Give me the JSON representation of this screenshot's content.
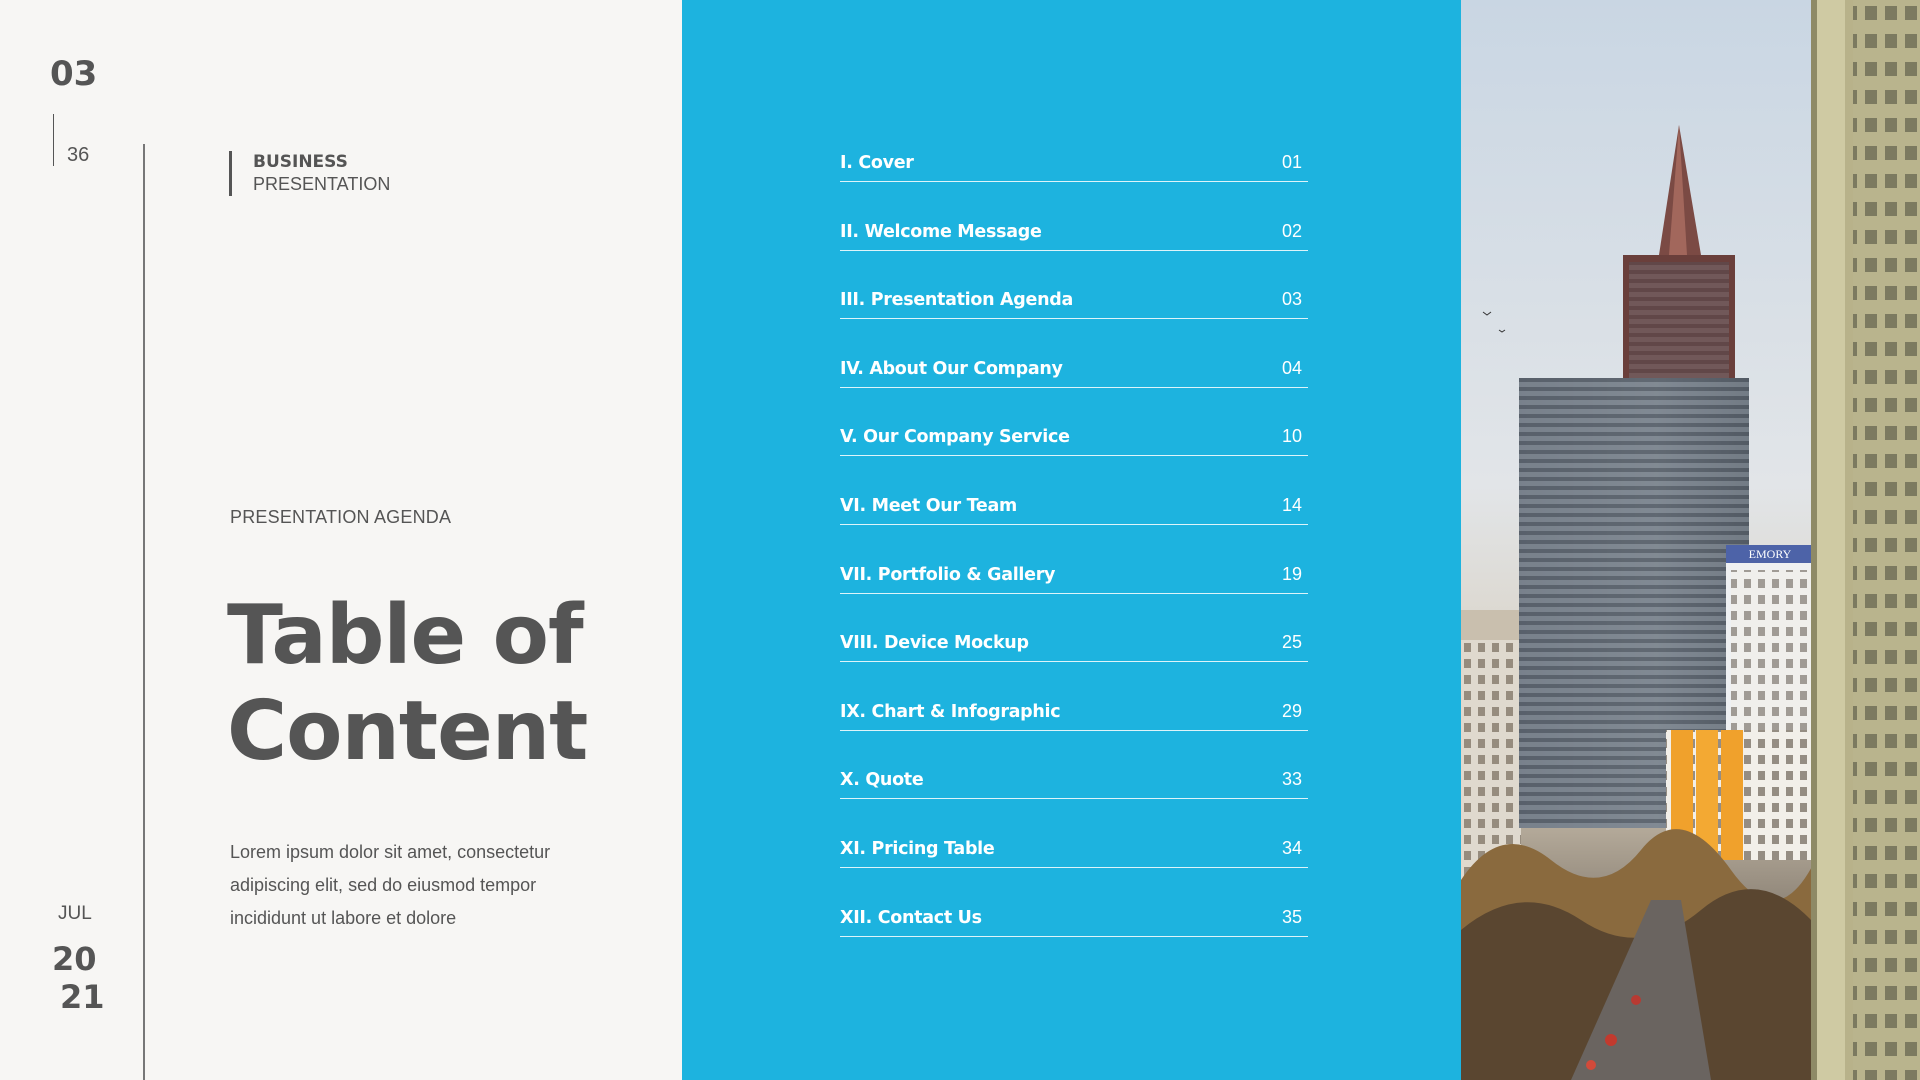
{
  "page": {
    "current": "03",
    "total": "36"
  },
  "brand": {
    "top": "BUSINESS",
    "bottom": "PRESENTATION"
  },
  "section": {
    "subtitle": "PRESENTATION AGENDA",
    "title_line1": "Table of",
    "title_line2": "Content",
    "description": "Lorem ipsum dolor sit amet, consectetur adipiscing elit, sed do eiusmod tempor incididunt ut labore et dolore"
  },
  "date": {
    "month": "JUL",
    "year_a": "20",
    "year_b": "21"
  },
  "toc": [
    {
      "label": "I. Cover",
      "page": "01"
    },
    {
      "label": "II. Welcome Message",
      "page": "02"
    },
    {
      "label": "III. Presentation Agenda",
      "page": "03"
    },
    {
      "label": "IV. About Our Company",
      "page": "04"
    },
    {
      "label": "V. Our Company Service",
      "page": "10"
    },
    {
      "label": "VI. Meet Our Team",
      "page": "14"
    },
    {
      "label": "VII. Portfolio & Gallery",
      "page": "19"
    },
    {
      "label": "VIII. Device Mockup",
      "page": "25"
    },
    {
      "label": "IX. Chart & Infographic",
      "page": "29"
    },
    {
      "label": "X. Quote",
      "page": "33"
    },
    {
      "label": "XI. Pricing Table",
      "page": "34"
    },
    {
      "label": "XII. Contact Us",
      "page": "35"
    }
  ],
  "photo": {
    "sign_text": "EMORY"
  },
  "colors": {
    "accent": "#1db3df",
    "text": "#555555",
    "background": "#f7f6f4"
  }
}
